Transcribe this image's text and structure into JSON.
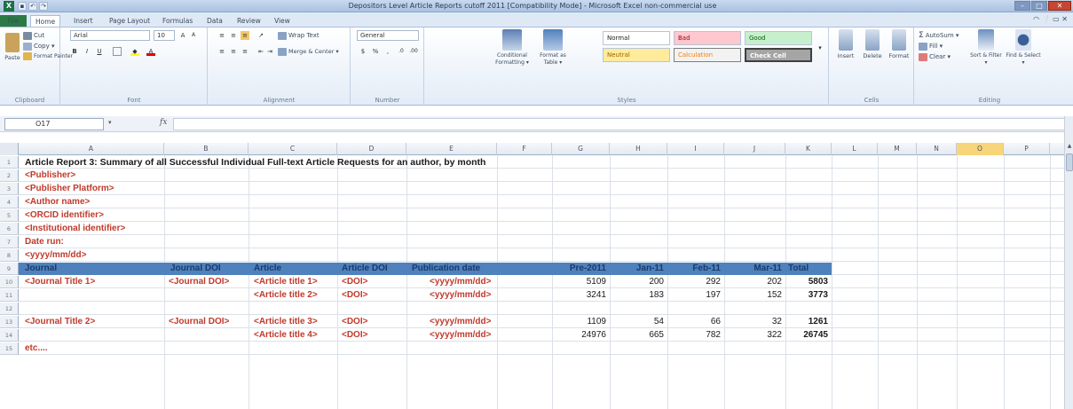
{
  "window": {
    "title": "Depositors Level Article Reports cutoff 2011 [Compatibility Mode] - Microsoft Excel non-commercial use",
    "controls": [
      "–",
      "□",
      "✕"
    ]
  },
  "ribbon_tabs": [
    "File",
    "Home",
    "Insert",
    "Page Layout",
    "Formulas",
    "Data",
    "Review",
    "View"
  ],
  "ribbon": {
    "clipboard": {
      "paste": "Paste",
      "cut": "Cut",
      "copy": "Copy ▾",
      "format_painter": "Format Painter",
      "label": "Clipboard"
    },
    "font": {
      "name": "Arial",
      "size": "10",
      "label": "Font"
    },
    "alignment": {
      "wrap": "Wrap Text",
      "merge": "Merge & Center ▾",
      "label": "Alignment"
    },
    "number": {
      "format": "General",
      "label": "Number"
    },
    "styles": {
      "conditional": "Conditional Formatting ▾",
      "format_table": "Format as Table ▾",
      "normal": "Normal",
      "bad": "Bad",
      "good": "Good",
      "neutral": "Neutral",
      "calculation": "Calculation",
      "check_cell": "Check Cell",
      "label": "Styles"
    },
    "cells": {
      "insert": "Insert",
      "delete": "Delete",
      "format": "Format",
      "label": "Cells"
    },
    "editing": {
      "autosum": "AutoSum ▾",
      "fill": "Fill ▾",
      "clear": "Clear ▾",
      "sort": "Sort & Filter ▾",
      "find": "Find & Select ▾",
      "label": "Editing"
    }
  },
  "formula_bar": {
    "name_box": "O17",
    "fx": "fx",
    "content": ""
  },
  "columns": [
    "A",
    "B",
    "C",
    "D",
    "E",
    "F",
    "G",
    "H",
    "I",
    "J",
    "K",
    "L",
    "M",
    "N",
    "O",
    "P"
  ],
  "selected_column": "O",
  "rows": [
    "1",
    "2",
    "3",
    "4",
    "5",
    "6",
    "7",
    "8",
    "9",
    "10",
    "11",
    "12",
    "13",
    "14",
    "15"
  ],
  "sheet": {
    "title": "Article Report 3: Summary  of all  Successful Individual Full-text Article Requests for an author, by month",
    "publisher": "<Publisher>",
    "platform": "<Publisher Platform>",
    "author": "<Author name>",
    "orcid": "<ORCID identifier>",
    "institutional": "<Institutional identifier>",
    "date_run": "Date run:",
    "date_format": "<yyyy/mm/dd>",
    "headers": [
      "Journal",
      "Journal DOI",
      "Article",
      "Article DOI",
      "Publication date",
      "Pre-2011",
      "Jan-11",
      "Feb-11",
      "Mar-11",
      "Total"
    ],
    "rows": [
      {
        "journal": "<Journal Title 1>",
        "journal_doi": "<Journal DOI>",
        "article": "<Article title 1>",
        "article_doi": "<DOI>",
        "pub_date": "<yyyy/mm/dd>",
        "pre2011": "5109",
        "jan": "200",
        "feb": "292",
        "mar": "202",
        "total": "5803"
      },
      {
        "journal": "",
        "journal_doi": "",
        "article": "<Article title 2>",
        "article_doi": "<DOI>",
        "pub_date": "<yyyy/mm/dd>",
        "pre2011": "3241",
        "jan": "183",
        "feb": "197",
        "mar": "152",
        "total": "3773"
      },
      {
        "journal": "<Journal Title 2>",
        "journal_doi": "<Journal DOI>",
        "article": "<Article title 3>",
        "article_doi": "<DOI>",
        "pub_date": "<yyyy/mm/dd>",
        "pre2011": "1109",
        "jan": "54",
        "feb": "66",
        "mar": "32",
        "total": "1261"
      },
      {
        "journal": "",
        "journal_doi": "",
        "article": "<Article title 4>",
        "article_doi": "<DOI>",
        "pub_date": "<yyyy/mm/dd>",
        "pre2011": "24976",
        "jan": "665",
        "feb": "782",
        "mar": "322",
        "total": "26745"
      }
    ],
    "etc": "etc...."
  }
}
